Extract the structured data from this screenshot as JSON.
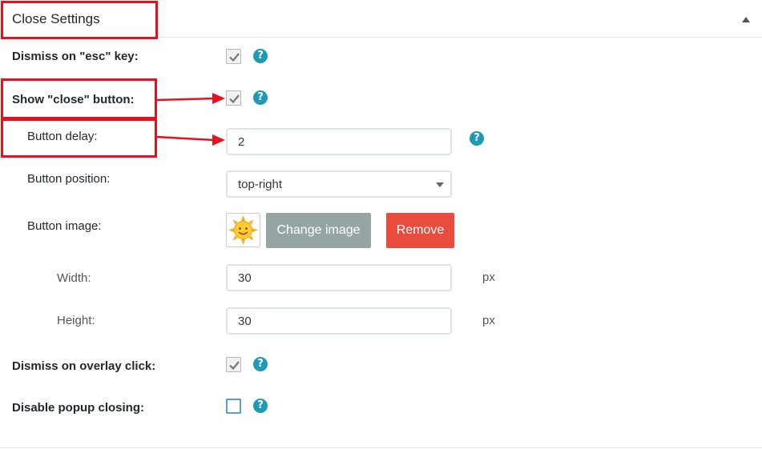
{
  "panel": {
    "title": "Close Settings",
    "toggle_icon": "triangle-up-icon"
  },
  "fields": {
    "dismiss_esc": {
      "label": "Dismiss on \"esc\" key:",
      "checked": true
    },
    "show_close": {
      "label": "Show \"close\" button:",
      "checked": true
    },
    "button_delay": {
      "label": "Button delay:",
      "value": "2"
    },
    "button_position": {
      "label": "Button position:",
      "value": "top-right"
    },
    "button_image": {
      "label": "Button image:",
      "change_label": "Change image",
      "remove_label": "Remove"
    },
    "width": {
      "label": "Width:",
      "value": "30",
      "unit": "px"
    },
    "height": {
      "label": "Height:",
      "value": "30",
      "unit": "px"
    },
    "dismiss_overlay": {
      "label": "Dismiss on overlay click:",
      "checked": true
    },
    "disable_closing": {
      "label": "Disable popup closing:",
      "checked": false
    }
  },
  "help_glyph": "?",
  "colors": {
    "help": "#1d9bb5",
    "change_button": "#95a5a6",
    "remove_button": "#e74c3c",
    "highlight": "#e8101b"
  }
}
